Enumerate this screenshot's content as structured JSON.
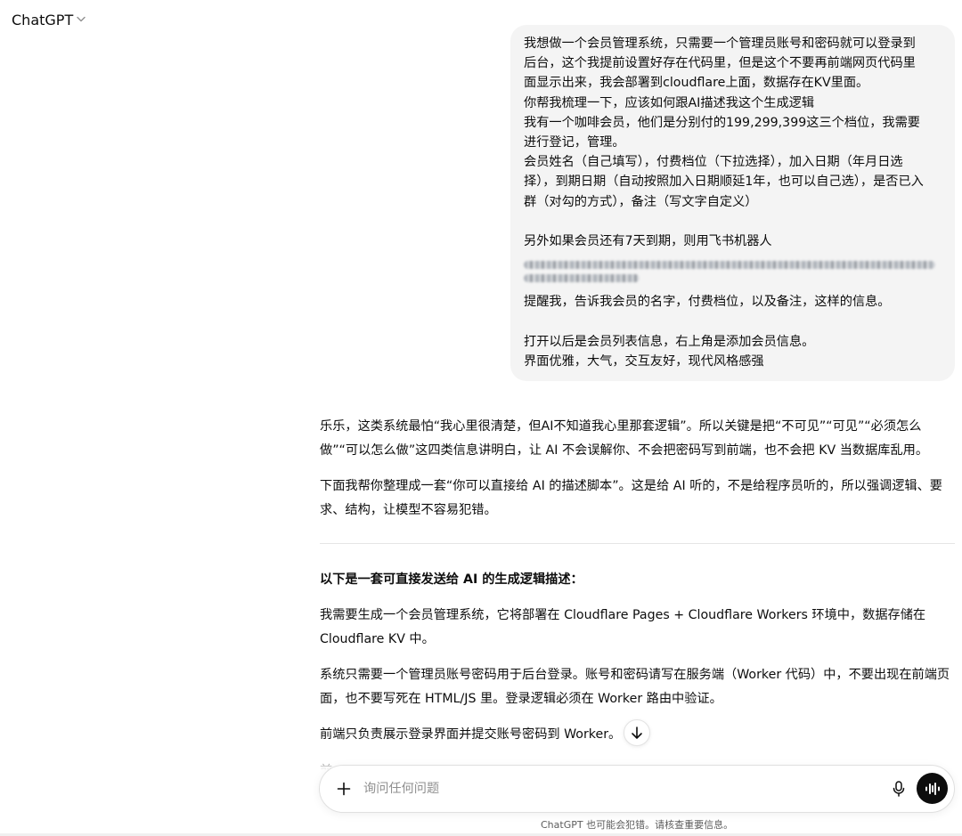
{
  "header": {
    "model_name": "ChatGPT"
  },
  "user_message": {
    "lines": [
      "我想做一个会员管理系统，只需要一个管理员账号和密码就可以登录到",
      "后台，这个我提前设置好存在代码里，但是这个不要再前端网页代码里",
      "面显示出来，我会部署到cloudflare上面，数据存在KV里面。",
      "你帮我梳理一下，应该如何跟AI描述我这个生成逻辑",
      "我有一个咖啡会员，他们是分别付的199,299,399这三个档位，我需要",
      "进行登记，管理。",
      "会员姓名（自己填写），付费档位（下拉选择），加入日期（年月日选",
      "择），到期日期（自动按照加入日期顺延1年，也可以自己选），是否已入",
      "群（对勾的方式），备注（写文字自定义）",
      "",
      "另外如果会员还有7天到期，则用飞书机器人"
    ],
    "lines_after": [
      "提醒我，告诉我会员的名字，付费档位，以及备注，这样的信息。",
      "",
      "打开以后是会员列表信息，右上角是添加会员信息。",
      "界面优雅，大气，交互友好，现代风格感强"
    ]
  },
  "assistant": {
    "intro_1": "乐乐，这类系统最怕“我心里很清楚，但AI不知道我心里那套逻辑”。所以关键是把“不可见”“可见”“必须怎么做”“可以怎么做”这四类信息讲明白，让 AI 不会误解你、不会把密码写到前端，也不会把 KV 当数据库乱用。",
    "intro_2": "下面我帮你整理成一套“你可以直接给 AI 的描述脚本”。这是给 AI 听的，不是给程序员听的，所以强调逻辑、要求、结构，让模型不容易犯错。",
    "section_heading": "以下是一套可直接发送给 AI 的生成逻辑描述：",
    "para_1": "我需要生成一个会员管理系统，它将部署在 Cloudflare Pages + Cloudflare Workers 环境中，数据存储在 Cloudflare KV 中。",
    "para_2": "系统只需要一个管理员账号密码用于后台登录。账号和密码请写在服务端（Worker 代码）中，不要出现在前端页面，也不要写死在 HTML/JS 里。登录逻辑必须在 Worker 路由中验证。",
    "para_3": "前端只负责展示登录界面并提交账号密码到 Worker。",
    "para_4_partial": "前"
  },
  "composer": {
    "placeholder": "询问任何问题"
  },
  "footer": {
    "disclaimer": "ChatGPT 也可能会犯错。请核查重要信息。"
  }
}
